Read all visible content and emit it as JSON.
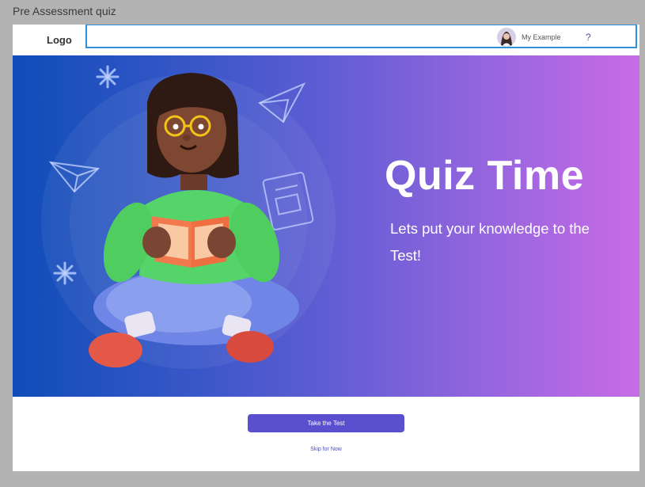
{
  "window": {
    "title": "Pre Assessment quiz"
  },
  "header": {
    "logo": "Logo",
    "user_name": "My Example",
    "help_label": "?"
  },
  "hero": {
    "title": "Quiz Time",
    "subtitle": "Lets put your knowledge to the Test!"
  },
  "actions": {
    "primary_label": "Take the Test",
    "secondary_label": "Skip for Now"
  },
  "colors": {
    "accent": "#5a4fcf",
    "link": "#4b52c4",
    "selection_outline": "#2f8fd8",
    "gradient_start": "#0f4db8",
    "gradient_end": "#c96be6"
  }
}
